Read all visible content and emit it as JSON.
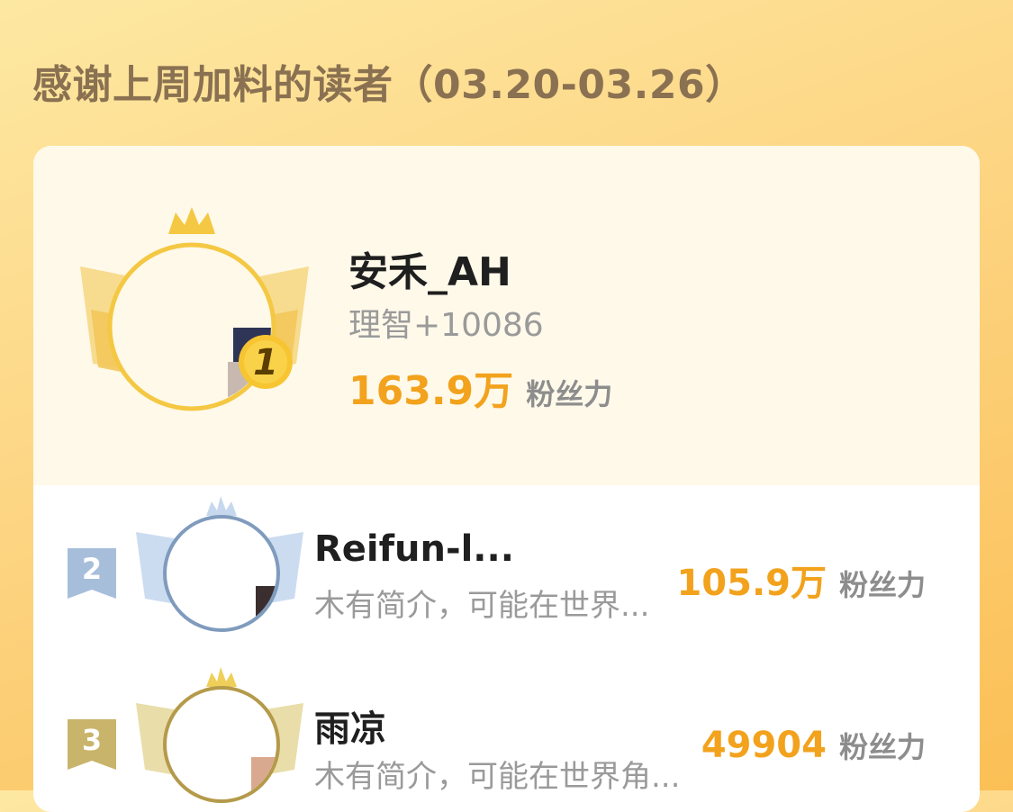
{
  "header": {
    "title": "感谢上周加料的读者（03.20-03.26）"
  },
  "colors": {
    "accent": "#f2a21c",
    "gold": "#f4c842",
    "silver": "#7f9bbd",
    "bronze": "#b49a4a"
  },
  "leaderboard": {
    "first": {
      "rank": "1",
      "name": "安禾_AH",
      "intro": "理智+10086",
      "power": "163.9万",
      "power_unit": "粉丝力"
    },
    "second": {
      "rank": "2",
      "name": "Reifun-l...",
      "intro": "木有简介，可能在世界...",
      "power": "105.9万",
      "power_unit": "粉丝力"
    },
    "third": {
      "rank": "3",
      "name": "雨凉",
      "intro": "木有简介，可能在世界角...",
      "power": "49904",
      "power_unit": "粉丝力"
    }
  }
}
